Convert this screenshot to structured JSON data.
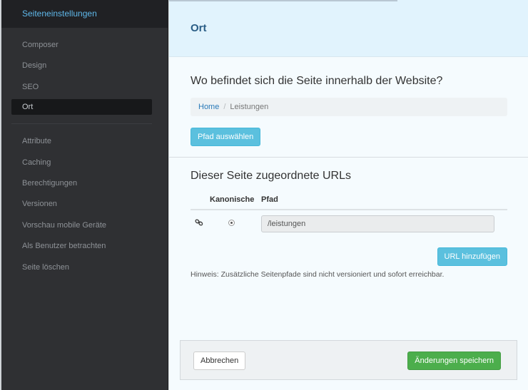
{
  "sidebar": {
    "title": "Seiteneinstellungen",
    "items_top": [
      {
        "label": "Composer"
      },
      {
        "label": "Design"
      },
      {
        "label": "SEO"
      },
      {
        "label": "Ort"
      }
    ],
    "items_bottom": [
      {
        "label": "Attribute"
      },
      {
        "label": "Caching"
      },
      {
        "label": "Berechtigungen"
      },
      {
        "label": "Versionen"
      },
      {
        "label": "Vorschau mobile Geräte"
      },
      {
        "label": "Als Benutzer betrachten"
      },
      {
        "label": "Seite löschen"
      }
    ]
  },
  "main": {
    "title": "Ort",
    "location_heading": "Wo befindet sich die Seite innerhalb der Website?",
    "breadcrumb": {
      "home": "Home",
      "separator": "/",
      "current": "Leistungen"
    },
    "select_path_button": "Pfad auswählen",
    "urls_heading": "Dieser Seite zugeordnete URLs",
    "table": {
      "col_canonical": "Kanonische",
      "col_path": "Pfad",
      "rows": [
        {
          "path": "/leistungen",
          "canonical": true
        }
      ]
    },
    "add_url_button": "URL hinzufügen",
    "hint": "Hinweis: Zusätzliche Seitenpfade sind nicht versioniert und sofort erreichbar."
  },
  "footer": {
    "cancel_button": "Abbrechen",
    "save_button": "Änderungen speichern"
  },
  "colors": {
    "accent": "#5bc0de",
    "success": "#4cae4c",
    "sidebar_bg": "#2f3033",
    "title": "#2a5d86"
  },
  "icons": {
    "link": "link-icon",
    "radio": "radio-selected"
  }
}
